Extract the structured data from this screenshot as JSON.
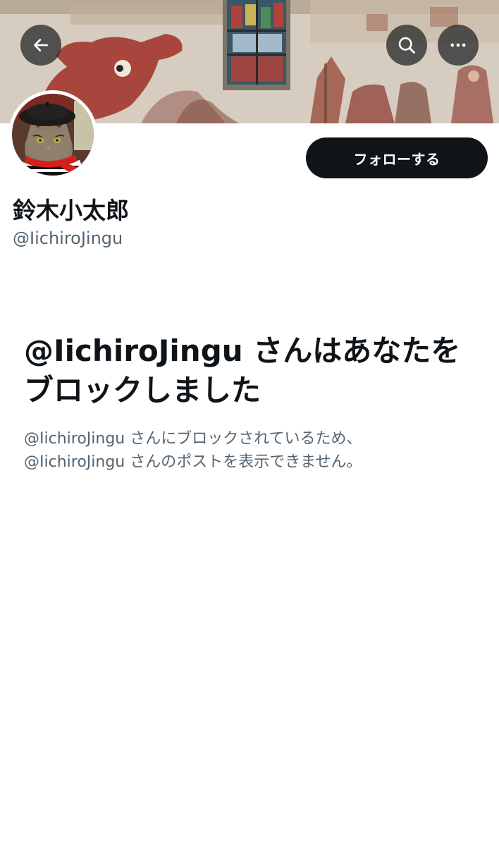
{
  "profile": {
    "display_name": "鈴木小太郎",
    "handle": "@IichiroJingu"
  },
  "header": {
    "back_icon": "arrow-left-icon",
    "search_icon": "search-icon",
    "more_icon": "more-horizontal-icon"
  },
  "actions": {
    "follow_label": "フォローする"
  },
  "blocked_notice": {
    "title": "@IichiroJingu さんはあなたをブロックしました",
    "description_line1": "@IichiroJingu さんにブロックされているため、",
    "description_line2": "@IichiroJingu さんのポストを表示できません。"
  },
  "colors": {
    "primary_text": "#0f1419",
    "secondary_text": "#536471",
    "button_bg": "#0f1419",
    "button_text": "#ffffff"
  }
}
